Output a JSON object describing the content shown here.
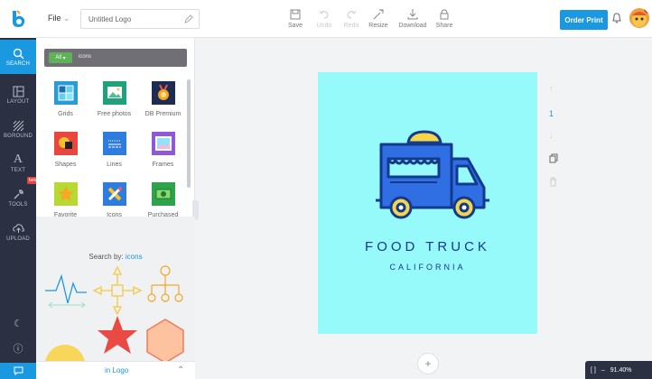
{
  "topbar": {
    "file_label": "File",
    "title_value": "Untitled Logo",
    "tools": [
      {
        "label": "Save",
        "icon": "save-icon"
      },
      {
        "label": "Undo",
        "icon": "undo-icon"
      },
      {
        "label": "Redo",
        "icon": "redo-icon"
      },
      {
        "label": "Resize",
        "icon": "resize-icon"
      },
      {
        "label": "Download",
        "icon": "download-icon"
      },
      {
        "label": "Share",
        "icon": "share-icon"
      }
    ],
    "order_print": "Order Print",
    "avatar_badge": ""
  },
  "rail": {
    "items": [
      {
        "label": "SEARCH",
        "icon": "search-icon"
      },
      {
        "label": "LAYOUT",
        "icon": "layout-icon"
      },
      {
        "label": "BGROUND",
        "icon": "background-icon"
      },
      {
        "label": "TEXT",
        "icon": "text-icon"
      },
      {
        "label": "TOOLS",
        "icon": "tools-icon"
      },
      {
        "label": "UPLOAD",
        "icon": "upload-icon"
      }
    ],
    "beta": "beta"
  },
  "panel": {
    "all_label": "All",
    "search_text": "icons",
    "categories": [
      {
        "label": "Grids"
      },
      {
        "label": "Free photos"
      },
      {
        "label": "DB Premium"
      },
      {
        "label": "Shapes"
      },
      {
        "label": "Lines"
      },
      {
        "label": "Frames"
      },
      {
        "label": "Favorite"
      },
      {
        "label": "Icons"
      },
      {
        "label": "Purchased"
      }
    ],
    "search_by_prefix": "Search by:",
    "search_by_term": "icons",
    "in_logo": "in Logo"
  },
  "canvas": {
    "title": "FOOD TRUCK",
    "subtitle": "CALIFORNIA",
    "page_number": "1"
  },
  "zoom": {
    "value": "91.40%"
  },
  "colors": {
    "accent": "#1a98e0",
    "rail": "#2b3042",
    "canvas_bg": "#96fafa",
    "logo_navy": "#133a8f",
    "logo_yellow": "#f5d54a"
  }
}
